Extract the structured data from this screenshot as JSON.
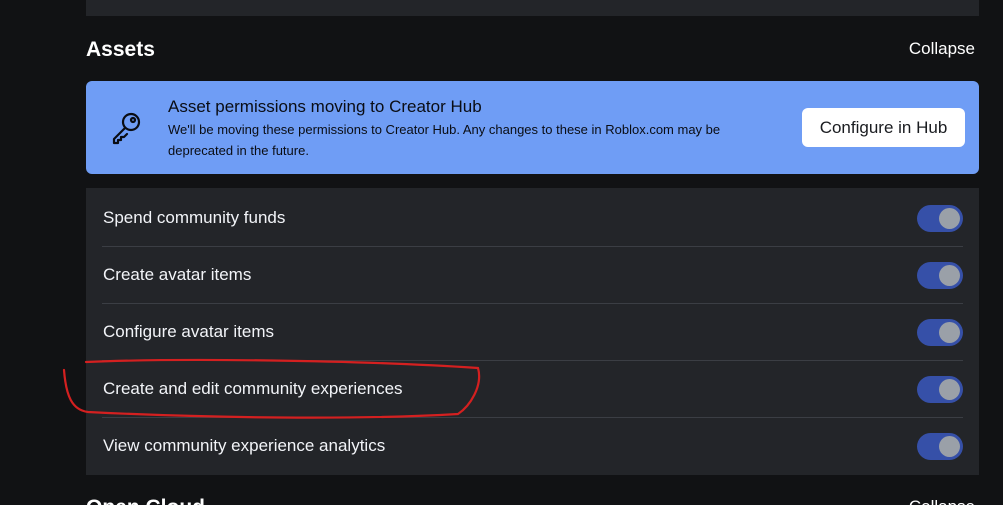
{
  "assets_section": {
    "title": "Assets",
    "collapse_label": "Collapse"
  },
  "banner": {
    "icon": "key-icon",
    "title": "Asset permissions moving to Creator Hub",
    "description": "We'll be moving these permissions to Creator Hub. Any changes to these in Roblox.com may be deprecated in the future.",
    "button_label": "Configure in Hub",
    "background_color": "#6f9df5"
  },
  "permissions": [
    {
      "label": "Spend community funds",
      "enabled": true
    },
    {
      "label": "Create avatar items",
      "enabled": true
    },
    {
      "label": "Configure avatar items",
      "enabled": true
    },
    {
      "label": "Create and edit community experiences",
      "enabled": true,
      "highlighted": true
    },
    {
      "label": "View community experience analytics",
      "enabled": true
    }
  ],
  "next_section": {
    "title": "Open Cloud",
    "collapse_label": "Collapse"
  },
  "colors": {
    "toggle_on": "#3650a8",
    "annotation": "#d42020"
  }
}
